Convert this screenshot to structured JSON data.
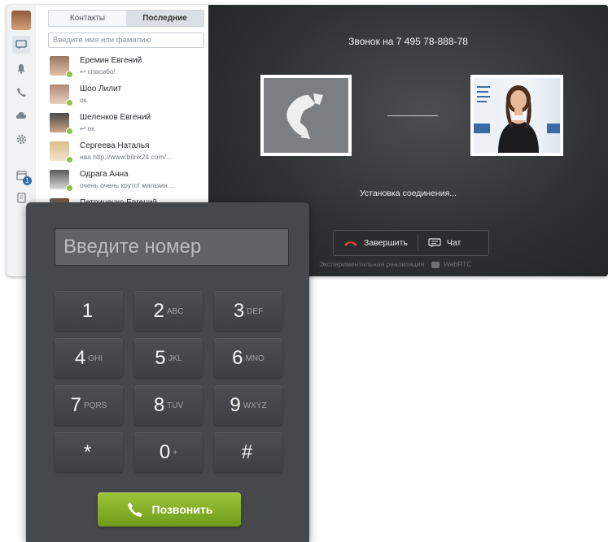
{
  "messenger": {
    "tabs": [
      "Контакты",
      "Последние"
    ],
    "search_placeholder": "Введите имя или фамилию",
    "contacts": [
      {
        "name": "Еремин Евгений",
        "message": "↩ спасибо!"
      },
      {
        "name": "Шоо Лилит",
        "message": "ок"
      },
      {
        "name": "Шеленков Евгений",
        "message": "↩ ок"
      },
      {
        "name": "Сергеева Наталья",
        "message": "нва http://www.bitrix24.com/..."
      },
      {
        "name": "Одрага Анна",
        "message": "очень очень круто! магазин ..."
      },
      {
        "name": "Петриченко Евгений",
        "message": ""
      }
    ],
    "leftbar": {
      "icons": [
        "avatar",
        "chat-icon",
        "bell-icon",
        "phone-icon",
        "cloud-icon",
        "gear-icon",
        "calendar-icon",
        "doc-icon"
      ],
      "badge": "1"
    }
  },
  "call": {
    "title": "Звонок на 7 495 78-888-78",
    "status": "Установка соединения...",
    "end_label": "Завершить",
    "chat_label": "Чат",
    "footer": "Экспериментальная реализация",
    "footer_brand": "WebRTC"
  },
  "dialpad": {
    "placeholder": "Введите номер",
    "keys": [
      {
        "digit": "1",
        "letters": ""
      },
      {
        "digit": "2",
        "letters": "ABC"
      },
      {
        "digit": "3",
        "letters": "DEF"
      },
      {
        "digit": "4",
        "letters": "GHI"
      },
      {
        "digit": "5",
        "letters": "JKL"
      },
      {
        "digit": "6",
        "letters": "MNO"
      },
      {
        "digit": "7",
        "letters": "PQRS"
      },
      {
        "digit": "8",
        "letters": "TUV"
      },
      {
        "digit": "9",
        "letters": "WXYZ"
      },
      {
        "digit": "*",
        "letters": ""
      },
      {
        "digit": "0",
        "letters": "+"
      },
      {
        "digit": "#",
        "letters": ""
      }
    ],
    "call_label": "Позвонить"
  },
  "colors": {
    "call_button": "#8bb32a",
    "end_call_icon": "#d9423a",
    "online": "#8bc34a"
  }
}
